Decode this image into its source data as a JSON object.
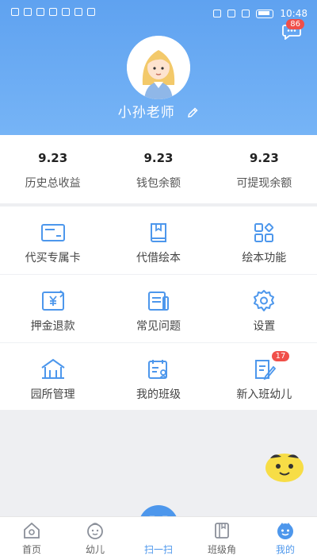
{
  "status_bar": {
    "time": "10:48"
  },
  "header": {
    "message_badge": "86",
    "teacher_name": "小孙老师"
  },
  "stats": [
    {
      "value": "9.23",
      "label": "历史总收益"
    },
    {
      "value": "9.23",
      "label": "钱包余额"
    },
    {
      "value": "9.23",
      "label": "可提现余额"
    }
  ],
  "grid": [
    {
      "label": "代买专属卡",
      "icon": "card-icon"
    },
    {
      "label": "代借绘本",
      "icon": "book-icon"
    },
    {
      "label": "绘本功能",
      "icon": "apps-icon"
    },
    {
      "label": "押金退款",
      "icon": "refund-icon"
    },
    {
      "label": "常见问题",
      "icon": "faq-icon"
    },
    {
      "label": "设置",
      "icon": "gear-icon"
    },
    {
      "label": "园所管理",
      "icon": "school-icon"
    },
    {
      "label": "我的班级",
      "icon": "class-icon"
    },
    {
      "label": "新入班幼儿",
      "icon": "new-child-icon",
      "badge": "17"
    }
  ],
  "tabbar": [
    {
      "label": "首页",
      "icon": "home-icon"
    },
    {
      "label": "幼儿",
      "icon": "child-icon"
    },
    {
      "label": "扫一扫",
      "icon": "scan-icon"
    },
    {
      "label": "班级角",
      "icon": "class-corner-icon"
    },
    {
      "label": "我的",
      "icon": "me-icon"
    }
  ],
  "colors": {
    "primary": "#4d97ec",
    "badge": "#f04f49",
    "header_top": "#5fa2f0",
    "header_bottom": "#76b4f6"
  }
}
